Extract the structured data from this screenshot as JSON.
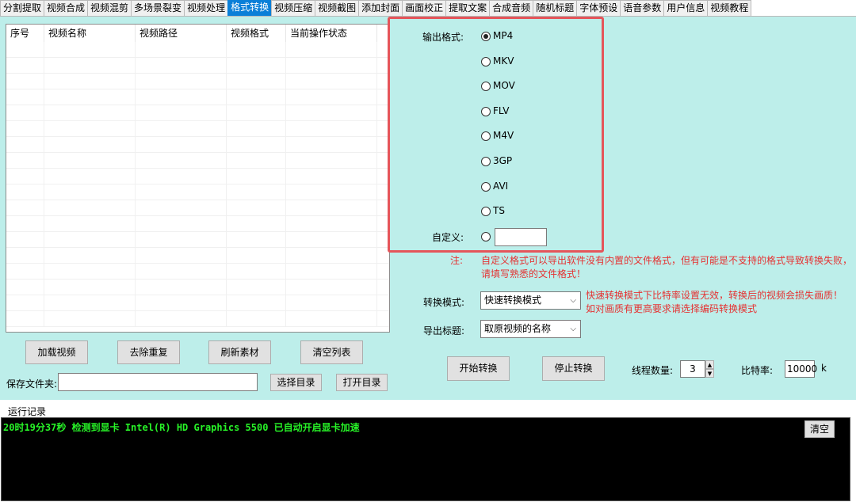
{
  "tabs": [
    {
      "label": "分割提取",
      "active": false
    },
    {
      "label": "视频合成",
      "active": false
    },
    {
      "label": "视频混剪",
      "active": false
    },
    {
      "label": "多场景裂变",
      "active": false
    },
    {
      "label": "视频处理",
      "active": false
    },
    {
      "label": "格式转换",
      "active": true
    },
    {
      "label": "视频压缩",
      "active": false
    },
    {
      "label": "视频截图",
      "active": false
    },
    {
      "label": "添加封面",
      "active": false
    },
    {
      "label": "画面校正",
      "active": false
    },
    {
      "label": "提取文案",
      "active": false
    },
    {
      "label": "合成音频",
      "active": false
    },
    {
      "label": "随机标题",
      "active": false
    },
    {
      "label": "字体预设",
      "active": false
    },
    {
      "label": "语音参数",
      "active": false
    },
    {
      "label": "用户信息",
      "active": false
    },
    {
      "label": "视频教程",
      "active": false
    }
  ],
  "table": {
    "headers": [
      "序号",
      "视频名称",
      "视频路径",
      "视频格式",
      "当前操作状态",
      ""
    ]
  },
  "buttons": {
    "load_video": "加载视频",
    "dedupe": "去除重复",
    "refresh": "刷新素材",
    "clear_list": "清空列表",
    "choose_dir": "选择目录",
    "open_dir": "打开目录",
    "start": "开始转换",
    "stop": "停止转换",
    "clear_log": "清空"
  },
  "save_folder": {
    "label": "保存文件夹:",
    "value": ""
  },
  "format": {
    "label": "输出格式:",
    "options": [
      "MP4",
      "MKV",
      "MOV",
      "FLV",
      "M4V",
      "3GP",
      "AVI",
      "TS"
    ],
    "selected": "MP4",
    "custom_label": "自定义:",
    "custom_value": ""
  },
  "note": {
    "label": "注:",
    "line1": "自定义格式可以导出软件没有内置的文件格式，但有可能是不支持的格式导致转换失败，",
    "line2": "请填写熟悉的文件格式！"
  },
  "convert_mode": {
    "label": "转换模式:",
    "value": "快速转换模式",
    "hint1": "快速转换模式下比特率设置无效，转换后的视频会损失画质！",
    "hint2": "如对画质有更高要求请选择编码转换模式"
  },
  "export_title": {
    "label": "导出标题:",
    "value": "取原视频的名称"
  },
  "threads": {
    "label": "线程数量:",
    "value": "3"
  },
  "bitrate": {
    "label": "比特率:",
    "value": "10000",
    "unit": "k"
  },
  "log": {
    "label": "运行记录",
    "line": "20时19分37秒 检测到显卡 Intel(R) HD Graphics 5500 已自动开启显卡加速"
  }
}
